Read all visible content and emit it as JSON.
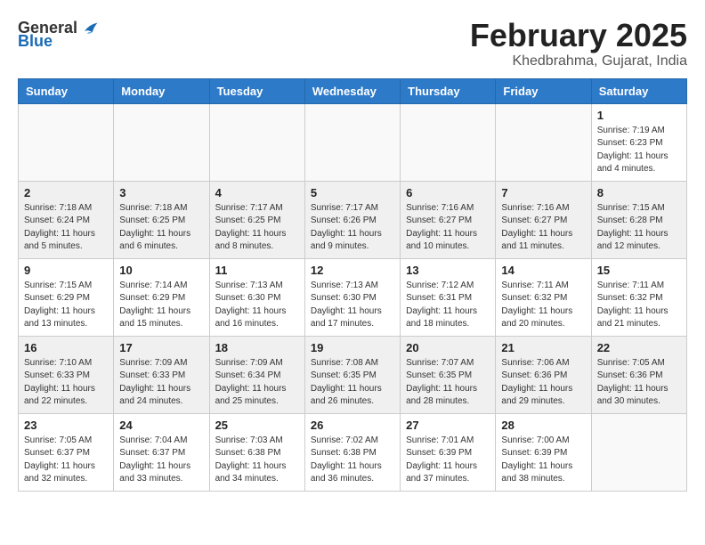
{
  "header": {
    "logo_general": "General",
    "logo_blue": "Blue",
    "month": "February 2025",
    "location": "Khedbrahma, Gujarat, India"
  },
  "weekdays": [
    "Sunday",
    "Monday",
    "Tuesday",
    "Wednesday",
    "Thursday",
    "Friday",
    "Saturday"
  ],
  "weeks": [
    [
      {
        "day": "",
        "info": ""
      },
      {
        "day": "",
        "info": ""
      },
      {
        "day": "",
        "info": ""
      },
      {
        "day": "",
        "info": ""
      },
      {
        "day": "",
        "info": ""
      },
      {
        "day": "",
        "info": ""
      },
      {
        "day": "1",
        "info": "Sunrise: 7:19 AM\nSunset: 6:23 PM\nDaylight: 11 hours\nand 4 minutes."
      }
    ],
    [
      {
        "day": "2",
        "info": "Sunrise: 7:18 AM\nSunset: 6:24 PM\nDaylight: 11 hours\nand 5 minutes."
      },
      {
        "day": "3",
        "info": "Sunrise: 7:18 AM\nSunset: 6:25 PM\nDaylight: 11 hours\nand 6 minutes."
      },
      {
        "day": "4",
        "info": "Sunrise: 7:17 AM\nSunset: 6:25 PM\nDaylight: 11 hours\nand 8 minutes."
      },
      {
        "day": "5",
        "info": "Sunrise: 7:17 AM\nSunset: 6:26 PM\nDaylight: 11 hours\nand 9 minutes."
      },
      {
        "day": "6",
        "info": "Sunrise: 7:16 AM\nSunset: 6:27 PM\nDaylight: 11 hours\nand 10 minutes."
      },
      {
        "day": "7",
        "info": "Sunrise: 7:16 AM\nSunset: 6:27 PM\nDaylight: 11 hours\nand 11 minutes."
      },
      {
        "day": "8",
        "info": "Sunrise: 7:15 AM\nSunset: 6:28 PM\nDaylight: 11 hours\nand 12 minutes."
      }
    ],
    [
      {
        "day": "9",
        "info": "Sunrise: 7:15 AM\nSunset: 6:29 PM\nDaylight: 11 hours\nand 13 minutes."
      },
      {
        "day": "10",
        "info": "Sunrise: 7:14 AM\nSunset: 6:29 PM\nDaylight: 11 hours\nand 15 minutes."
      },
      {
        "day": "11",
        "info": "Sunrise: 7:13 AM\nSunset: 6:30 PM\nDaylight: 11 hours\nand 16 minutes."
      },
      {
        "day": "12",
        "info": "Sunrise: 7:13 AM\nSunset: 6:30 PM\nDaylight: 11 hours\nand 17 minutes."
      },
      {
        "day": "13",
        "info": "Sunrise: 7:12 AM\nSunset: 6:31 PM\nDaylight: 11 hours\nand 18 minutes."
      },
      {
        "day": "14",
        "info": "Sunrise: 7:11 AM\nSunset: 6:32 PM\nDaylight: 11 hours\nand 20 minutes."
      },
      {
        "day": "15",
        "info": "Sunrise: 7:11 AM\nSunset: 6:32 PM\nDaylight: 11 hours\nand 21 minutes."
      }
    ],
    [
      {
        "day": "16",
        "info": "Sunrise: 7:10 AM\nSunset: 6:33 PM\nDaylight: 11 hours\nand 22 minutes."
      },
      {
        "day": "17",
        "info": "Sunrise: 7:09 AM\nSunset: 6:33 PM\nDaylight: 11 hours\nand 24 minutes."
      },
      {
        "day": "18",
        "info": "Sunrise: 7:09 AM\nSunset: 6:34 PM\nDaylight: 11 hours\nand 25 minutes."
      },
      {
        "day": "19",
        "info": "Sunrise: 7:08 AM\nSunset: 6:35 PM\nDaylight: 11 hours\nand 26 minutes."
      },
      {
        "day": "20",
        "info": "Sunrise: 7:07 AM\nSunset: 6:35 PM\nDaylight: 11 hours\nand 28 minutes."
      },
      {
        "day": "21",
        "info": "Sunrise: 7:06 AM\nSunset: 6:36 PM\nDaylight: 11 hours\nand 29 minutes."
      },
      {
        "day": "22",
        "info": "Sunrise: 7:05 AM\nSunset: 6:36 PM\nDaylight: 11 hours\nand 30 minutes."
      }
    ],
    [
      {
        "day": "23",
        "info": "Sunrise: 7:05 AM\nSunset: 6:37 PM\nDaylight: 11 hours\nand 32 minutes."
      },
      {
        "day": "24",
        "info": "Sunrise: 7:04 AM\nSunset: 6:37 PM\nDaylight: 11 hours\nand 33 minutes."
      },
      {
        "day": "25",
        "info": "Sunrise: 7:03 AM\nSunset: 6:38 PM\nDaylight: 11 hours\nand 34 minutes."
      },
      {
        "day": "26",
        "info": "Sunrise: 7:02 AM\nSunset: 6:38 PM\nDaylight: 11 hours\nand 36 minutes."
      },
      {
        "day": "27",
        "info": "Sunrise: 7:01 AM\nSunset: 6:39 PM\nDaylight: 11 hours\nand 37 minutes."
      },
      {
        "day": "28",
        "info": "Sunrise: 7:00 AM\nSunset: 6:39 PM\nDaylight: 11 hours\nand 38 minutes."
      },
      {
        "day": "",
        "info": ""
      }
    ]
  ]
}
